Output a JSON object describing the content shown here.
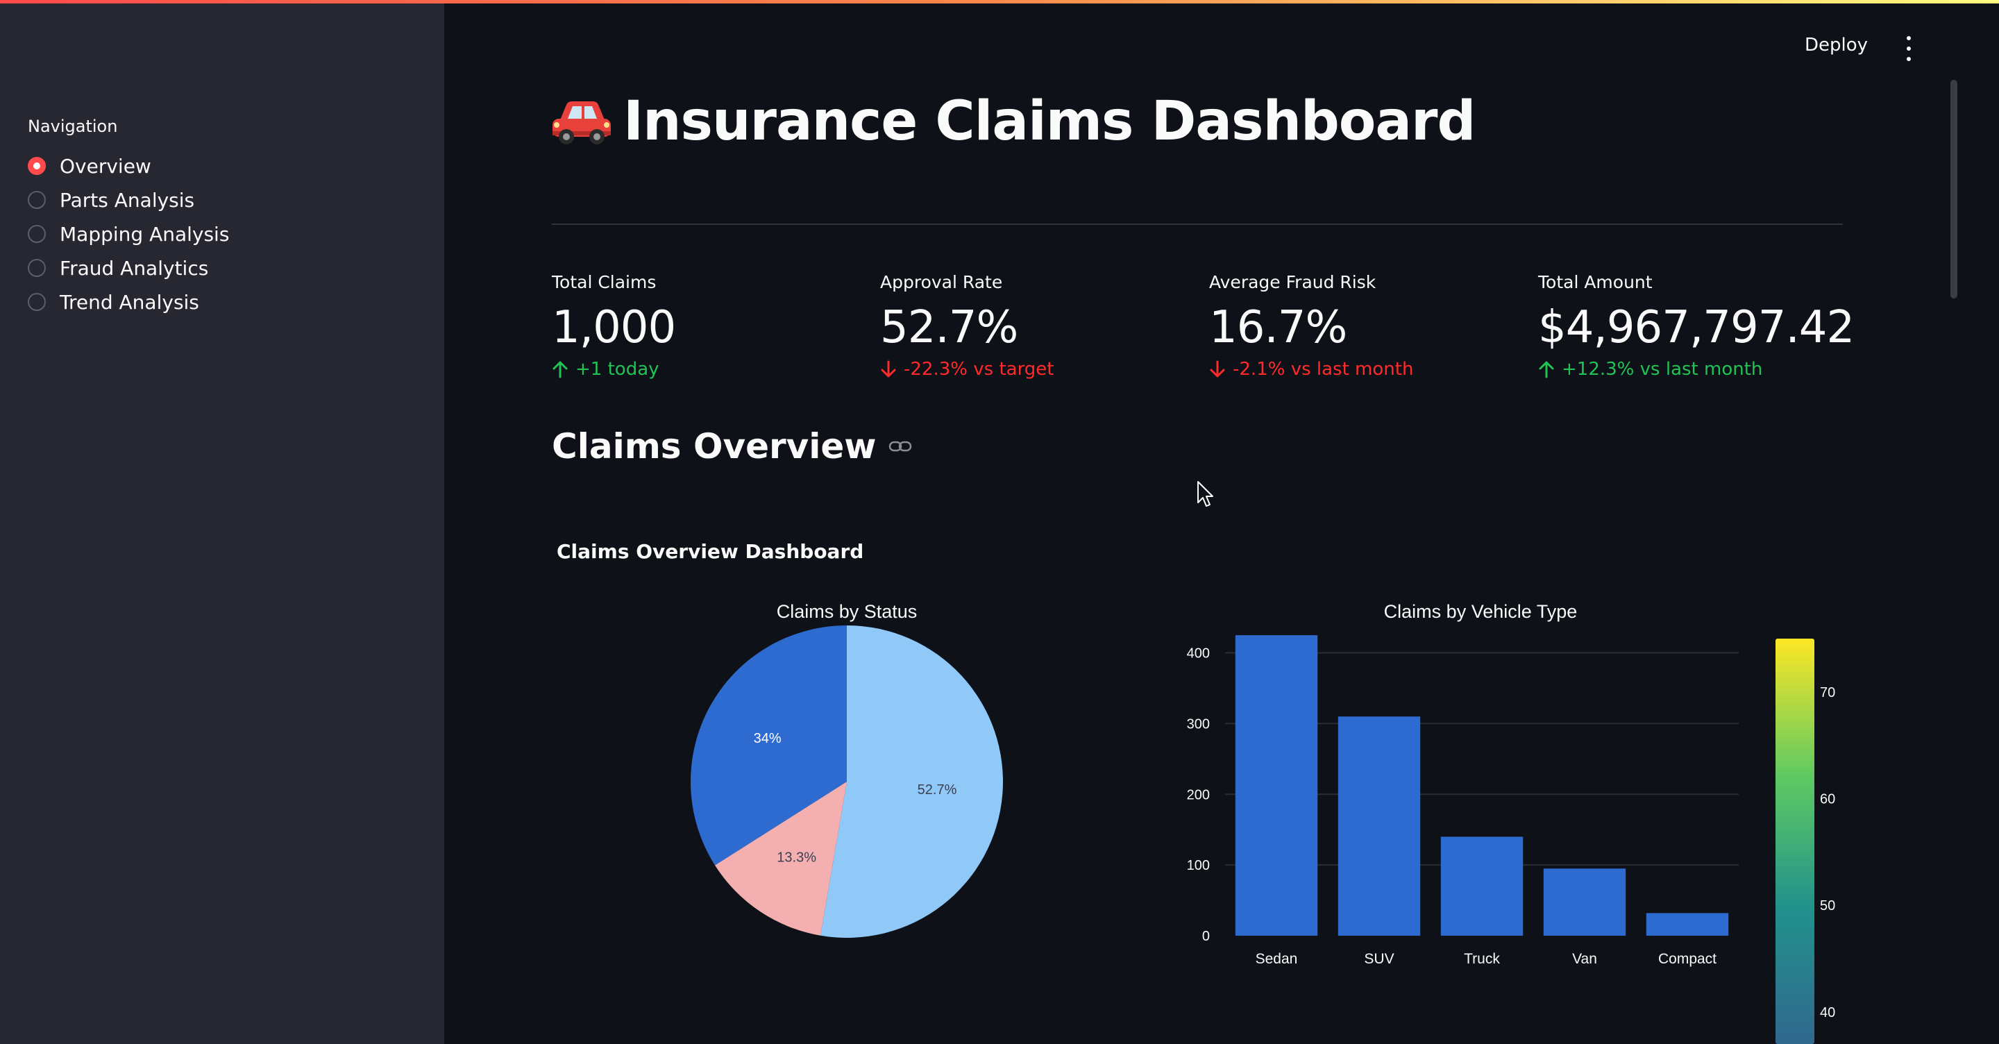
{
  "app": {
    "deploy_label": "Deploy"
  },
  "sidebar": {
    "title": "Navigation",
    "items": [
      {
        "label": "Overview",
        "selected": true
      },
      {
        "label": "Parts Analysis",
        "selected": false
      },
      {
        "label": "Mapping Analysis",
        "selected": false
      },
      {
        "label": "Fraud Analytics",
        "selected": false
      },
      {
        "label": "Trend Analysis",
        "selected": false
      }
    ]
  },
  "header": {
    "title": "Insurance Claims Dashboard",
    "title_icon": "car-icon"
  },
  "metrics": [
    {
      "label": "Total Claims",
      "value": "1,000",
      "delta": "+1 today",
      "direction": "up"
    },
    {
      "label": "Approval Rate",
      "value": "52.7%",
      "delta": "-22.3% vs target",
      "direction": "down"
    },
    {
      "label": "Average Fraud Risk",
      "value": "16.7%",
      "delta": "-2.1% vs last month",
      "direction": "down"
    },
    {
      "label": "Total Amount",
      "value": "$4,967,797.42",
      "delta": "+12.3% vs last month",
      "direction": "up"
    }
  ],
  "section": {
    "title": "Claims Overview",
    "anchor_icon": "link-icon"
  },
  "dashboard_title": "Claims Overview Dashboard",
  "colors": {
    "accent": "#ff4b4b",
    "positive": "#21c354",
    "negative": "#ff2b2b",
    "bar": "#2e6bd0"
  },
  "chart_data": [
    {
      "type": "pie",
      "title": "Claims by Status",
      "slices": [
        {
          "label": "52.7%",
          "value": 52.7,
          "color": "#90c8f8"
        },
        {
          "label": "13.3%",
          "value": 13.3,
          "color": "#f4b0b0"
        },
        {
          "label": "34%",
          "value": 34.0,
          "color": "#2e6bd0"
        }
      ]
    },
    {
      "type": "bar",
      "title": "Claims by Vehicle Type",
      "categories": [
        "Sedan",
        "SUV",
        "Truck",
        "Van",
        "Compact"
      ],
      "values": [
        425,
        310,
        140,
        95,
        32
      ],
      "ylim": [
        0,
        430
      ],
      "yticks": [
        0,
        100,
        200,
        300,
        400
      ],
      "grid": true,
      "colorbar": {
        "ticks": [
          40,
          50,
          60,
          70
        ],
        "range": [
          37,
          75
        ],
        "colorscale": "viridis"
      }
    }
  ]
}
